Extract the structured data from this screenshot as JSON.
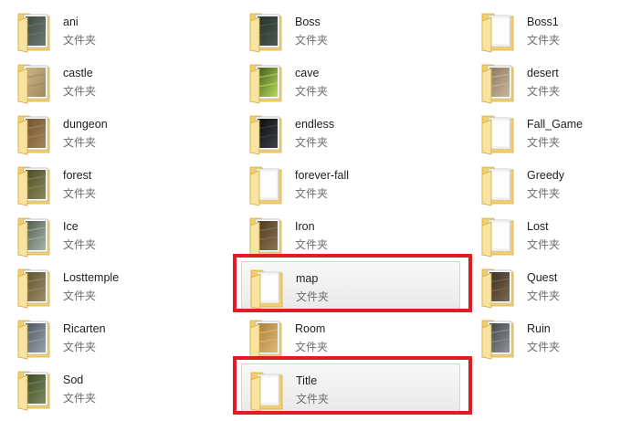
{
  "folder_type": "文件夹",
  "colors": {
    "folder_back": "#f2cf6b",
    "folder_front": "#f8e3a0",
    "highlight": "#e01b24"
  },
  "items": [
    {
      "name": "ani",
      "thumb": "dark-stone",
      "selected": false,
      "highlighted": false
    },
    {
      "name": "Boss",
      "thumb": "dark-teal",
      "selected": false,
      "highlighted": false
    },
    {
      "name": "Boss1",
      "thumb": "blank",
      "selected": false,
      "highlighted": false
    },
    {
      "name": "castle",
      "thumb": "sand",
      "selected": false,
      "highlighted": false
    },
    {
      "name": "cave",
      "thumb": "green-orb",
      "selected": false,
      "highlighted": false
    },
    {
      "name": "desert",
      "thumb": "tan-rock",
      "selected": false,
      "highlighted": false
    },
    {
      "name": "dungeon",
      "thumb": "brown-stone",
      "selected": false,
      "highlighted": false
    },
    {
      "name": "endless",
      "thumb": "black",
      "selected": false,
      "highlighted": false
    },
    {
      "name": "Fall_Game",
      "thumb": "blank",
      "selected": false,
      "highlighted": false
    },
    {
      "name": "forest",
      "thumb": "olive",
      "selected": false,
      "highlighted": false
    },
    {
      "name": "forever-fall",
      "thumb": "blank",
      "selected": false,
      "highlighted": false
    },
    {
      "name": "Greedy",
      "thumb": "blank",
      "selected": false,
      "highlighted": false
    },
    {
      "name": "Ice",
      "thumb": "ice",
      "selected": false,
      "highlighted": false
    },
    {
      "name": "Iron",
      "thumb": "brown-metal",
      "selected": false,
      "highlighted": false
    },
    {
      "name": "Lost",
      "thumb": "blank",
      "selected": false,
      "highlighted": false
    },
    {
      "name": "Losttemple",
      "thumb": "temple",
      "selected": false,
      "highlighted": false
    },
    {
      "name": "map",
      "thumb": "blank",
      "selected": true,
      "highlighted": true
    },
    {
      "name": "Quest",
      "thumb": "dark-brown",
      "selected": false,
      "highlighted": false
    },
    {
      "name": "Ricarten",
      "thumb": "gray-blue",
      "selected": false,
      "highlighted": false
    },
    {
      "name": "Room",
      "thumb": "wood",
      "selected": false,
      "highlighted": false
    },
    {
      "name": "Ruin",
      "thumb": "gray-pattern",
      "selected": false,
      "highlighted": false
    },
    {
      "name": "Sod",
      "thumb": "moss",
      "selected": false,
      "highlighted": false
    },
    {
      "name": "Title",
      "thumb": "blank",
      "selected": true,
      "highlighted": true
    }
  ]
}
